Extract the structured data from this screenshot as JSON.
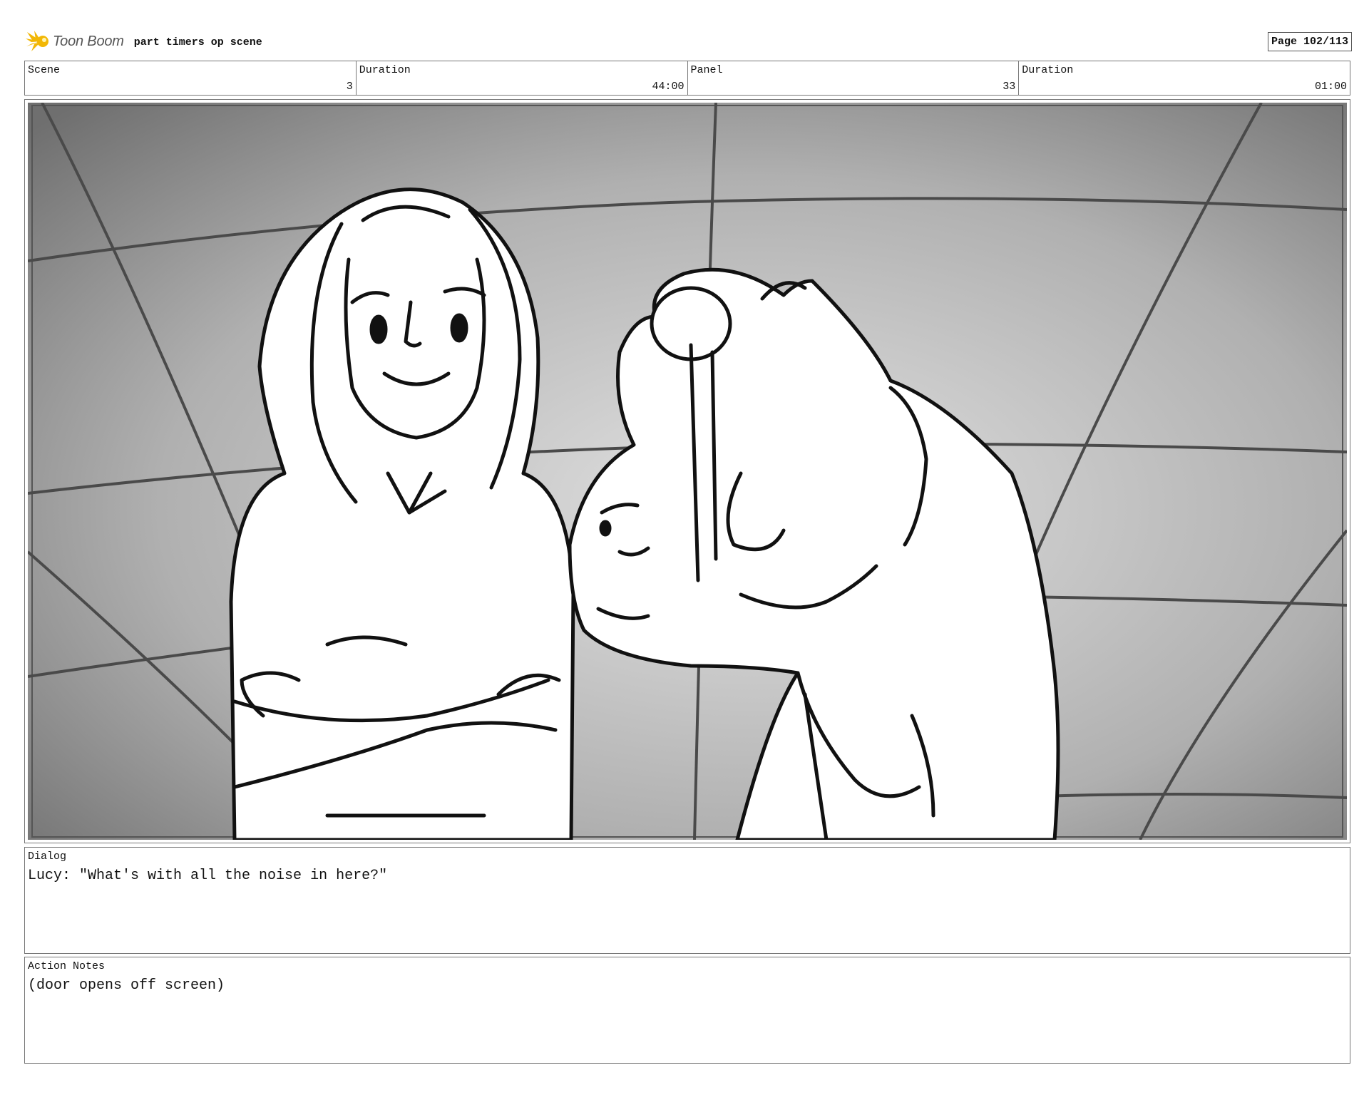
{
  "header": {
    "logo_text": "Toon Boom",
    "project_title": "part timers op scene",
    "page_label": "Page 102/113"
  },
  "info": {
    "scene_label": "Scene",
    "scene_value": "3",
    "scene_duration_label": "Duration",
    "scene_duration_value": "44:00",
    "panel_label": "Panel",
    "panel_value": "33",
    "panel_duration_label": "Duration",
    "panel_duration_value": "01:00"
  },
  "panel": {
    "image_icon": "storyboard-sketch-two-characters"
  },
  "dialog": {
    "label": "Dialog",
    "text": "Lucy: \"What's with all the noise in here?\""
  },
  "action_notes": {
    "label": "Action Notes",
    "text": "(door opens off screen)"
  },
  "colors": {
    "logo_accent": "#f2b705",
    "border": "#777777",
    "panel_bg_light": "#d8d8d8",
    "panel_bg_dark": "#7a7a7a"
  }
}
